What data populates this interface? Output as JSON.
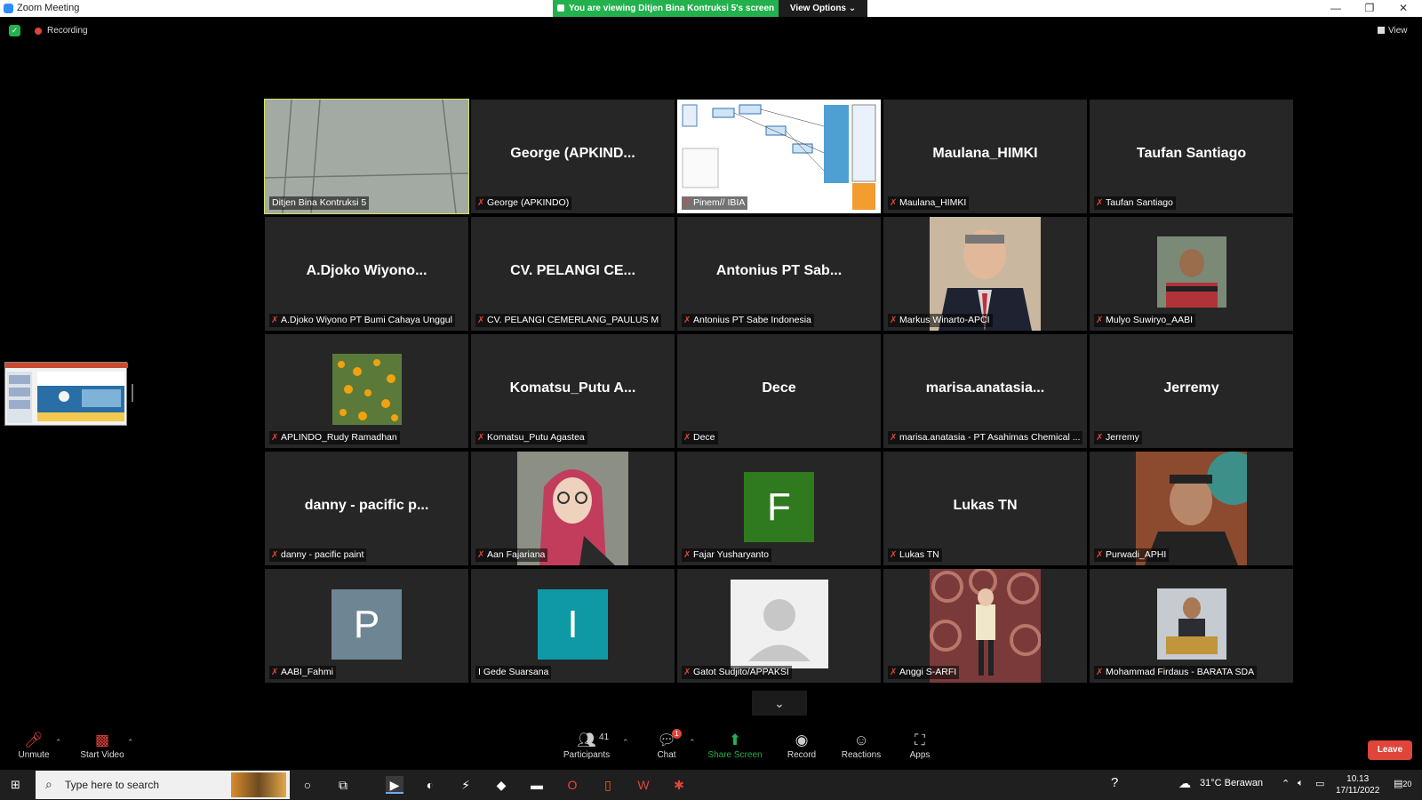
{
  "window": {
    "title": "Zoom Meeting",
    "minimize": "—",
    "restore": "❐",
    "close": "✕"
  },
  "share_banner": {
    "text": "You are viewing Ditjen Bina Kontruksi 5's screen",
    "view_options": "View Options ⌄"
  },
  "status": {
    "recording": "Recording",
    "view": "View"
  },
  "tiles": [
    {
      "big": "",
      "name": "Ditjen Bina Kontruksi 5",
      "muted": false,
      "type": "wall",
      "active": true
    },
    {
      "big": "George  (APKIND...",
      "name": "George (APKINDO)",
      "muted": true
    },
    {
      "big": "",
      "name": "Pinem// IBIA",
      "muted": true,
      "type": "diagram"
    },
    {
      "big": "Maulana_HIMKI",
      "name": "Maulana_HIMKI",
      "muted": true
    },
    {
      "big": "Taufan Santiago",
      "name": "Taufan Santiago",
      "muted": true
    },
    {
      "big": "A.Djoko  Wiyono...",
      "name": "A.Djoko Wiyono PT Bumi Cahaya Unggul",
      "muted": true
    },
    {
      "big": "CV. PELANGI CE...",
      "name": "CV. PELANGI CEMERLANG_PAULUS M",
      "muted": true
    },
    {
      "big": "Antonius PT Sab...",
      "name": "Antonius PT Sabe Indonesia",
      "muted": true
    },
    {
      "big": "",
      "name": "Markus Winarto-APCI",
      "muted": true,
      "type": "photo-man-suit"
    },
    {
      "big": "",
      "name": "Mulyo Suwiryo_AABI",
      "muted": true,
      "type": "photo-small"
    },
    {
      "big": "",
      "name": "APLINDO_Rudy Ramadhan",
      "muted": true,
      "type": "photo-flowers"
    },
    {
      "big": "Komatsu_Putu  A...",
      "name": "Komatsu_Putu Agastea",
      "muted": true
    },
    {
      "big": "Dece",
      "name": "Dece",
      "muted": true
    },
    {
      "big": "marisa.anatasia...",
      "name": "marisa.anatasia - PT Asahimas Chemical ...",
      "muted": true
    },
    {
      "big": "Jerremy",
      "name": "Jerremy",
      "muted": true
    },
    {
      "big": "danny - pacific p...",
      "name": "danny - pacific paint",
      "muted": true
    },
    {
      "big": "",
      "name": "Aan Fajariana",
      "muted": true,
      "type": "photo-woman"
    },
    {
      "big": "",
      "name": "Fajar Yusharyanto",
      "muted": true,
      "type": "letter",
      "letter": "F",
      "color": "#2f7a1f"
    },
    {
      "big": "Lukas TN",
      "name": "Lukas TN",
      "muted": true
    },
    {
      "big": "",
      "name": "Purwadi_APHI",
      "muted": true,
      "type": "photo-man-batik"
    },
    {
      "big": "",
      "name": "AABI_Fahmi",
      "muted": true,
      "type": "letter",
      "letter": "P",
      "color": "#6e8594"
    },
    {
      "big": "",
      "name": "I Gede Suarsana",
      "muted": false,
      "type": "letter",
      "letter": "I",
      "color": "#0f99a7"
    },
    {
      "big": "",
      "name": "Gatot Sudjito/APPAKSI",
      "muted": true,
      "type": "default-avatar"
    },
    {
      "big": "",
      "name": "Anggi S-ARFI",
      "muted": true,
      "type": "photo-coils"
    },
    {
      "big": "",
      "name": "Mohammad Firdaus - BARATA SDA",
      "muted": true,
      "type": "photo-small-2"
    }
  ],
  "toolbar": {
    "unmute": "Unmute",
    "start_video": "Start Video",
    "participants": "Participants",
    "participants_count": "41",
    "chat": "Chat",
    "chat_badge": "1",
    "share_screen": "Share Screen",
    "record": "Record",
    "reactions": "Reactions",
    "apps": "Apps",
    "leave": "Leave"
  },
  "taskbar": {
    "search_placeholder": "Type here to search",
    "weather": "31°C  Berawan",
    "time": "10.13",
    "date": "17/11/2022",
    "notifications": "20"
  }
}
